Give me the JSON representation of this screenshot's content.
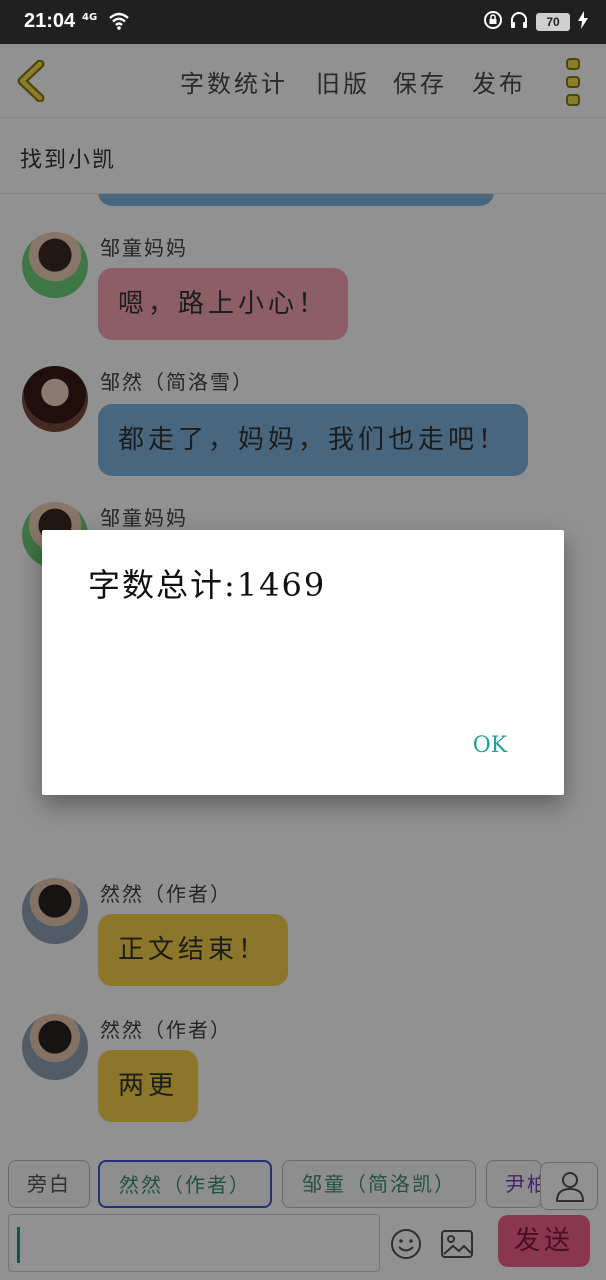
{
  "status_bar": {
    "time": "21:04",
    "network": "4G",
    "battery": "70"
  },
  "header": {
    "menu": [
      "字数统计",
      "旧版",
      "保存",
      "发布"
    ]
  },
  "story_title": "找到小凯",
  "messages": [
    {
      "sender": "邹童妈妈",
      "text": "嗯，路上小心！",
      "color": "#f5a6b8"
    },
    {
      "sender": "邹然（简洛雪）",
      "text": "都走了，妈妈，我们也走吧！",
      "color": "#7fb6e0"
    },
    {
      "sender": "邹童妈妈",
      "text": "",
      "color": "#f5a6b8"
    },
    {
      "sender": "然然（作者）",
      "text": "正文结束！",
      "color": "#f7d04a"
    },
    {
      "sender": "然然（作者）",
      "text": "两更",
      "color": "#f7d04a"
    }
  ],
  "roles": [
    "旁白",
    "然然（作者）",
    "邹童（简洛凯）",
    "尹柏"
  ],
  "input": {
    "value": ""
  },
  "send_label": "发送",
  "dialog": {
    "message": "字数总计:1469",
    "ok_label": "OK"
  }
}
